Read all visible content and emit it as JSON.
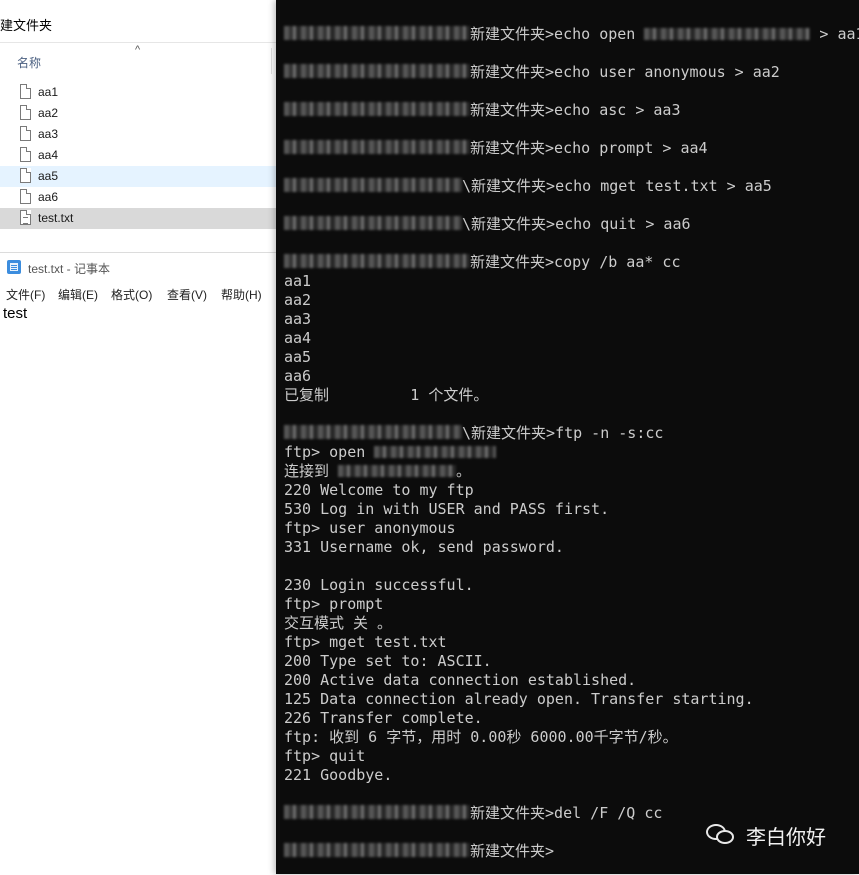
{
  "explorer": {
    "title": "建文件夹",
    "column_name": "名称",
    "files": [
      {
        "name": "aa1",
        "icon": "file-icon"
      },
      {
        "name": "aa2",
        "icon": "file-icon"
      },
      {
        "name": "aa3",
        "icon": "file-icon"
      },
      {
        "name": "aa4",
        "icon": "file-icon"
      },
      {
        "name": "aa5",
        "icon": "file-icon"
      },
      {
        "name": "aa6",
        "icon": "file-icon"
      },
      {
        "name": "test.txt",
        "icon": "text-file-icon"
      }
    ]
  },
  "notepad": {
    "title": "test.txt - 记事本",
    "menu": [
      "文件(F)",
      "编辑(E)",
      "格式(O)",
      "查看(V)",
      "帮助(H)"
    ],
    "content": "test"
  },
  "console": {
    "lines": {
      "l1": {
        "prompt": "新建文件夹>",
        "cmd": "echo open",
        "tail": " > aa1"
      },
      "l2": {
        "prompt": "新建文件夹>",
        "cmd": "echo user anonymous > aa2"
      },
      "l3": {
        "prompt": "新建文件夹>",
        "cmd": "echo asc > aa3"
      },
      "l4": {
        "prompt": "新建文件夹>",
        "cmd": "echo prompt > aa4"
      },
      "l5": {
        "prompt": "\\新建文件夹>",
        "cmd": "echo mget test.txt > aa5"
      },
      "l6": {
        "prompt": "\\新建文件夹>",
        "cmd": "echo quit > aa6"
      },
      "l7": {
        "prompt": "新建文件夹>",
        "cmd": "copy /b aa* cc"
      },
      "o1": "aa1",
      "o2": "aa2",
      "o3": "aa3",
      "o4": "aa4",
      "o5": "aa5",
      "o6": "aa6",
      "o7": "已复制         1 个文件。",
      "l8": {
        "prompt": "\\新建文件夹>",
        "cmd": "ftp -n -s:cc"
      },
      "f1": "ftp> open",
      "f2a": "连接到",
      "f2b": "。",
      "f3": "220 Welcome to my ftp",
      "f4": "530 Log in with USER and PASS first.",
      "f5": "ftp> user anonymous",
      "f6": "331 Username ok, send password.",
      "f7": "230 Login successful.",
      "f8": "ftp> prompt",
      "f9": "交互模式 关 。",
      "f10": "ftp> mget test.txt",
      "f11": "200 Type set to: ASCII.",
      "f12": "200 Active data connection established.",
      "f13": "125 Data connection already open. Transfer starting.",
      "f14": "226 Transfer complete.",
      "f15": "ftp: 收到 6 字节，用时 0.00秒 6000.00千字节/秒。",
      "f16": "ftp> quit",
      "f17": "221 Goodbye.",
      "l9": {
        "prompt": "新建文件夹>",
        "cmd": "del /F /Q cc"
      },
      "l10": {
        "prompt": "新建文件夹>",
        "cmd": ""
      }
    }
  },
  "watermark": {
    "text": "李白你好",
    "icon": "wechat-icon"
  },
  "colors": {
    "console_bg": "#0c0c0c",
    "console_text": "#cccccc",
    "selected_row": "#e5f3ff",
    "selected_row_gray": "#d9d9d9"
  }
}
